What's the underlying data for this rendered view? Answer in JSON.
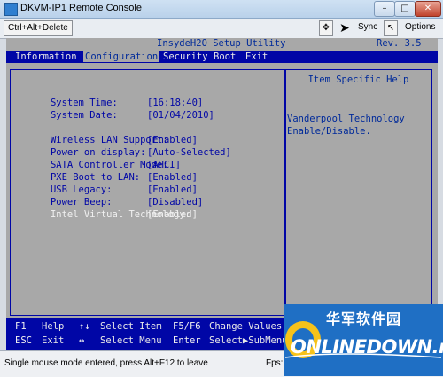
{
  "window": {
    "title": "DKVM-IP1 Remote Console",
    "controls": {
      "minimize": "–",
      "maximize": "□",
      "close": "✕"
    }
  },
  "toolbar": {
    "ctrl_alt_delete": "Ctrl+Alt+Delete",
    "fit_icon": "✥",
    "cursor_icon": "➤",
    "sync_label": "Sync",
    "cursor_icon_2": "↖",
    "options_label": "Options"
  },
  "bios": {
    "title": "InsydeH2O Setup Utility",
    "rev": "Rev. 3.5",
    "menu": [
      "Information",
      "Configuration",
      "Security",
      "Boot",
      "Exit"
    ],
    "active_menu": "Configuration",
    "settings": [
      {
        "label": "System Time:",
        "value": "[16:18:40]"
      },
      {
        "label": "System Date:",
        "value": "[01/04/2010]"
      },
      {
        "label": "Wireless LAN Support:",
        "value": "[Enabled]"
      },
      {
        "label": "Power on display:",
        "value": "[Auto-Selected]"
      },
      {
        "label": "SATA Controller Mode:",
        "value": "[AHCI]"
      },
      {
        "label": "PXE Boot to LAN:",
        "value": "[Enabled]"
      },
      {
        "label": "USB Legacy:",
        "value": "[Enabled]"
      },
      {
        "label": "Power Beep:",
        "value": "[Disabled]"
      },
      {
        "label": "Intel Virtual Technology:",
        "value": "[Enabled]"
      }
    ],
    "help": {
      "title": "Item Specific Help",
      "text": "Vanderpool Technology\nEnable/Disable."
    },
    "keyhelp": [
      {
        "key": "F1",
        "desc": "Help"
      },
      {
        "key": "↑↓",
        "desc": "Select Item"
      },
      {
        "key": "F5/F6",
        "desc": "Change Values"
      },
      {
        "key": "ESC",
        "desc": "Exit"
      },
      {
        "key": "↔",
        "desc": "Select Menu"
      },
      {
        "key": "Enter",
        "desc": "Select▶SubMenu"
      }
    ]
  },
  "statusbar": {
    "message": "Single mouse mode entered, press Alt+F12 to leave",
    "fps_label": "Fps:"
  },
  "watermark": {
    "chinese": "华军软件园",
    "english": "ONLINEDOWN.net"
  },
  "colors": {
    "bios_bg": "#a8a8a8",
    "bios_blue": "#0006a6",
    "highlight_text": "#f1f1f1",
    "watermark_blue": "#1f6fc4"
  }
}
